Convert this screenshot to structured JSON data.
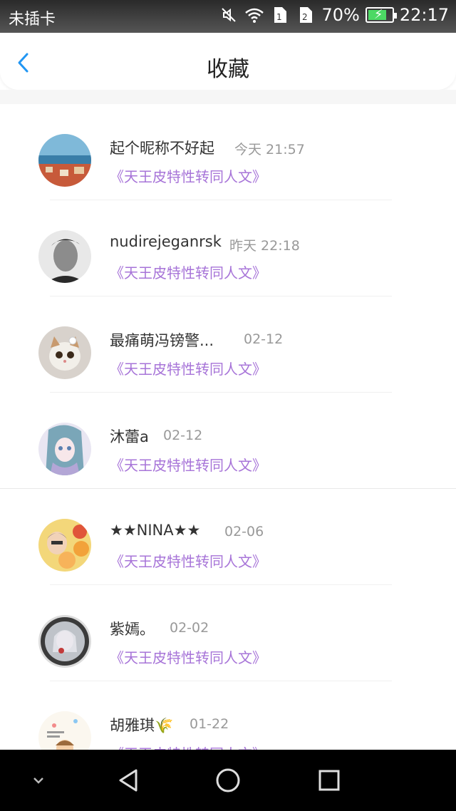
{
  "status": {
    "carrier": "未插卡",
    "battery": "70%",
    "time": "22:17"
  },
  "header": {
    "title": "收藏"
  },
  "items": [
    {
      "name": "起个昵称不好起",
      "time": "今天 21:57",
      "book": "《天王皮特性转同人文》"
    },
    {
      "name": "nudirejeganrsk",
      "time": "昨天 22:18",
      "book": "《天王皮特性转同人文》"
    },
    {
      "name": "最痛萌冯镑警...",
      "time": "02-12",
      "book": "《天王皮特性转同人文》"
    },
    {
      "name": "沐蕾a",
      "time": "02-12",
      "book": "《天王皮特性转同人文》"
    },
    {
      "name": "★★NINA★★",
      "time": "02-06",
      "book": "《天王皮特性转同人文》"
    },
    {
      "name": "紫嫣。",
      "time": "02-02",
      "book": "《天王皮特性转同人文》"
    },
    {
      "name": "胡雅琪🌾",
      "time": "01-22",
      "book": "《天王皮特性转同人文》"
    }
  ]
}
